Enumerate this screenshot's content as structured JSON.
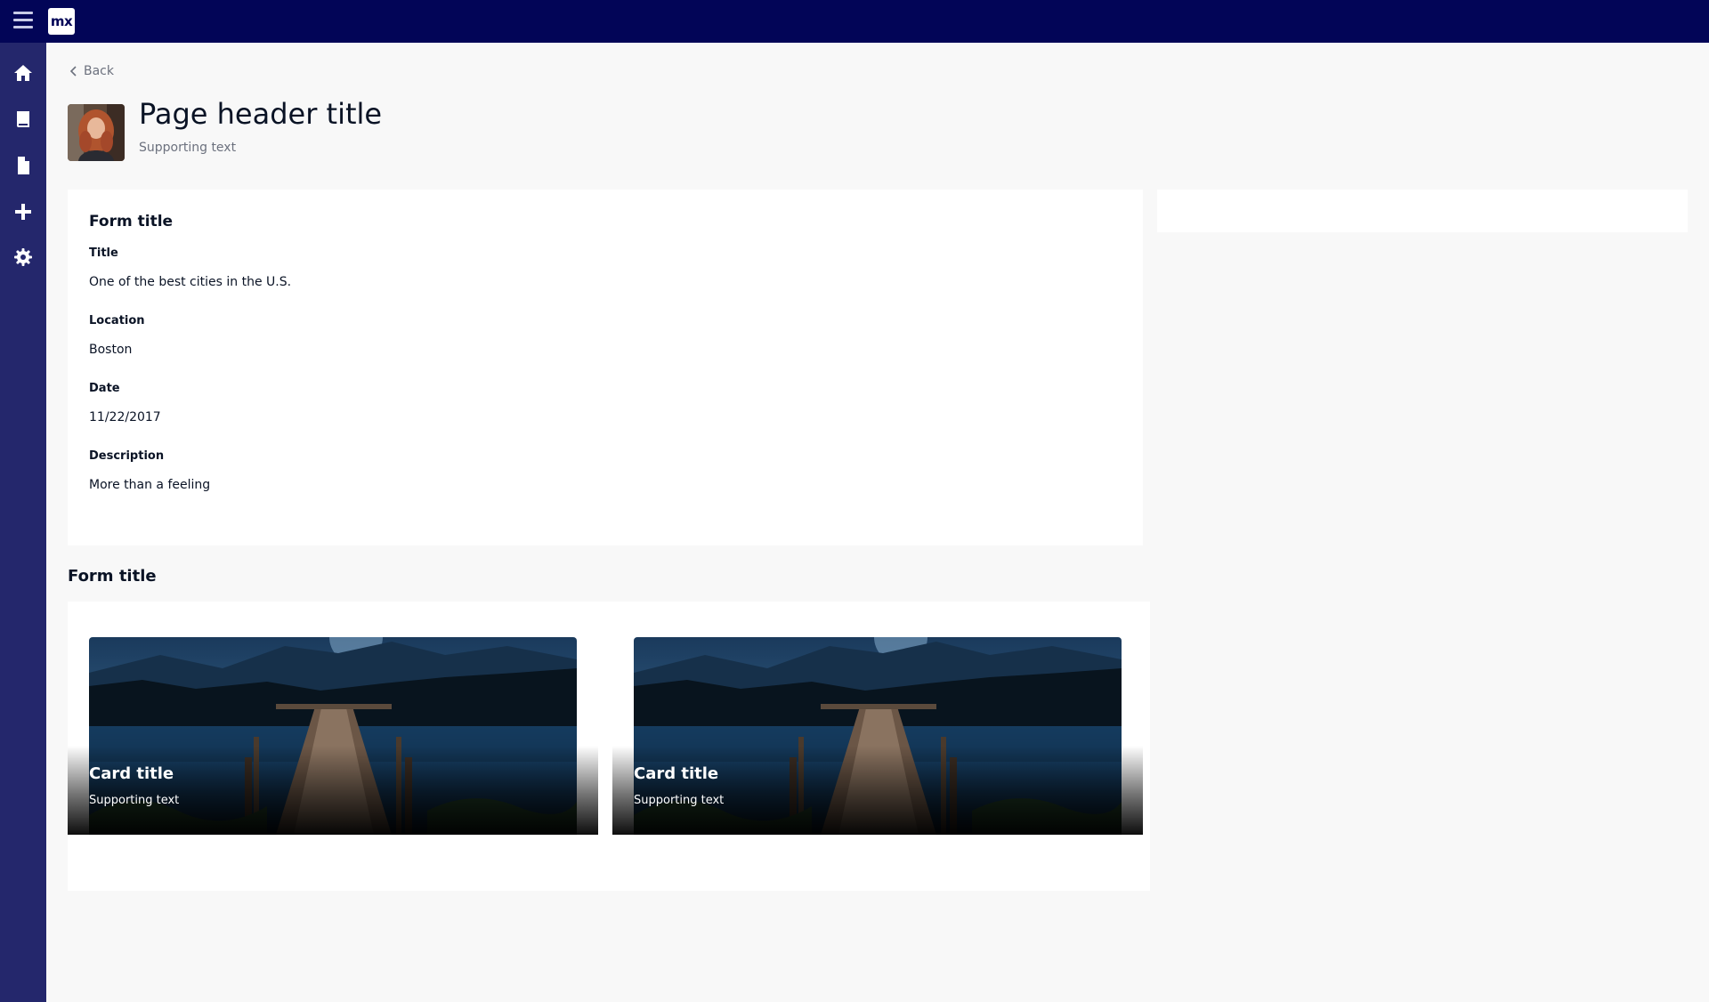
{
  "app": {
    "logo_text": "mx",
    "brand_color": "#020557",
    "sidebar_color": "#24276c"
  },
  "sidebar": {
    "items": [
      {
        "icon": "home-icon"
      },
      {
        "icon": "book-icon"
      },
      {
        "icon": "document-icon"
      },
      {
        "icon": "plus-icon"
      },
      {
        "icon": "gear-icon"
      }
    ]
  },
  "header": {
    "back_label": "Back",
    "title": "Page header title",
    "subtitle": "Supporting text"
  },
  "form": {
    "title": "Form title",
    "fields": [
      {
        "label": "Title",
        "value": "One of the best cities in the U.S."
      },
      {
        "label": "Location",
        "value": "Boston"
      },
      {
        "label": "Date",
        "value": "11/22/2017"
      },
      {
        "label": "Description",
        "value": "More than a feeling"
      }
    ]
  },
  "gallery": {
    "title": "Form title",
    "cards": [
      {
        "title": "Card title",
        "subtitle": "Supporting text"
      },
      {
        "title": "Card title",
        "subtitle": "Supporting text"
      }
    ]
  }
}
